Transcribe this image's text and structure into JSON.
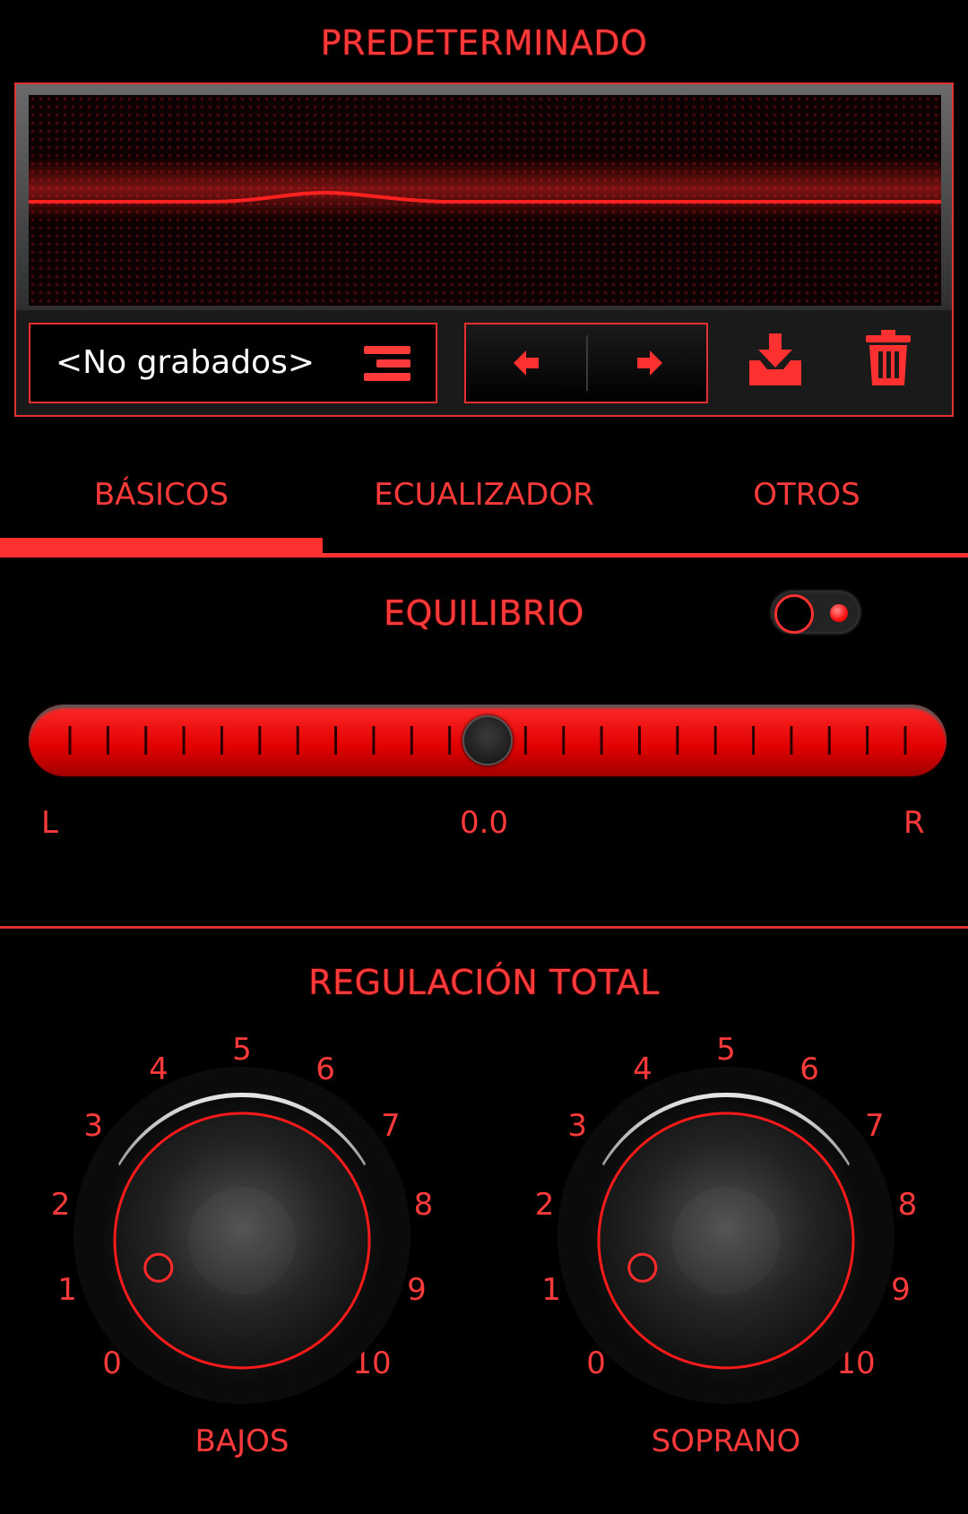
{
  "header": {
    "title": "PREDETERMINADO"
  },
  "preset": {
    "name": "<No grabados>",
    "menu_icon": "list-menu-icon"
  },
  "nav": {
    "prev_icon": "arrow-left-icon",
    "next_icon": "arrow-right-icon"
  },
  "actions": {
    "save_icon": "download-save-icon",
    "delete_icon": "trash-icon"
  },
  "tabs": [
    {
      "label": "BÁSICOS",
      "active": true
    },
    {
      "label": "ECUALIZADOR",
      "active": false
    },
    {
      "label": "OTROS",
      "active": false
    }
  ],
  "balance": {
    "title": "EQUILIBRIO",
    "enabled": true,
    "value": 0.5,
    "left_label": "L",
    "center_value": "0.0",
    "right_label": "R"
  },
  "global": {
    "title": "REGULACIÓN TOTAL",
    "scale": [
      "0",
      "1",
      "2",
      "3",
      "4",
      "5",
      "6",
      "7",
      "8",
      "9",
      "10"
    ],
    "knobs": [
      {
        "label": "BAJOS",
        "value": 1
      },
      {
        "label": "SOPRANO",
        "value": 1
      }
    ]
  },
  "colors": {
    "accent": "#ff3a3a",
    "background": "#000000"
  }
}
